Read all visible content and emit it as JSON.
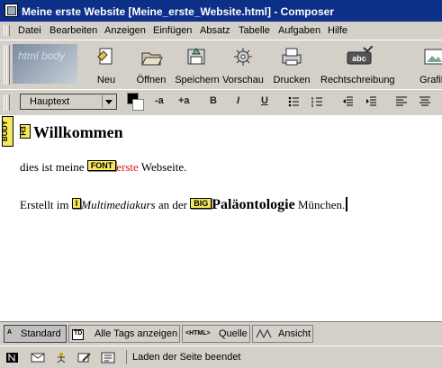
{
  "window": {
    "title": "Meine erste Website [Meine_erste_Website.html] - Composer"
  },
  "menu": [
    "Datei",
    "Bearbeiten",
    "Anzeigen",
    "Einfügen",
    "Absatz",
    "Tabelle",
    "Aufgaben",
    "Hilfe"
  ],
  "toolbar": {
    "logo_text": "html body",
    "buttons": [
      {
        "label": "Neu",
        "icon": "new-page-icon"
      },
      {
        "label": "Öffnen",
        "icon": "open-folder-icon"
      },
      {
        "label": "Speichern",
        "icon": "save-icon"
      },
      {
        "label": "Vorschau",
        "icon": "preview-icon"
      },
      {
        "label": "Drucken",
        "icon": "print-icon"
      },
      {
        "label": "Rechtschreibung",
        "icon": "spellcheck-icon"
      },
      {
        "label": "Grafik",
        "icon": "image-icon"
      }
    ],
    "spellcheck_icon_text": "abc"
  },
  "format": {
    "paragraph_style": "Hauptext",
    "buttons": [
      "-a",
      "+a",
      "B",
      "I",
      "U"
    ],
    "text_color": "#000000",
    "background_color": "#ffffff"
  },
  "editor": {
    "body_tag": "BODY",
    "heading_tag": "H3",
    "heading": "Willkommen",
    "line1": {
      "before": "dies ist meine ",
      "tag": "FONT",
      "red": "erste",
      "after": " Webseite."
    },
    "line2": {
      "before": "Erstellt im ",
      "tag_i": "I",
      "italic": "Multimediakurs",
      "middle": " an der ",
      "tag_big": "BIG",
      "big": "Paläontologie",
      "after": " München."
    }
  },
  "tabs": [
    {
      "label": "Standard",
      "icon": "A"
    },
    {
      "label": "Alle Tags anzeigen",
      "icon": "TD"
    },
    {
      "label": "Quelle",
      "icon": "<HTML>"
    },
    {
      "label": "Ansicht",
      "icon": ""
    }
  ],
  "status": {
    "text": "Laden der Seite beendet"
  }
}
